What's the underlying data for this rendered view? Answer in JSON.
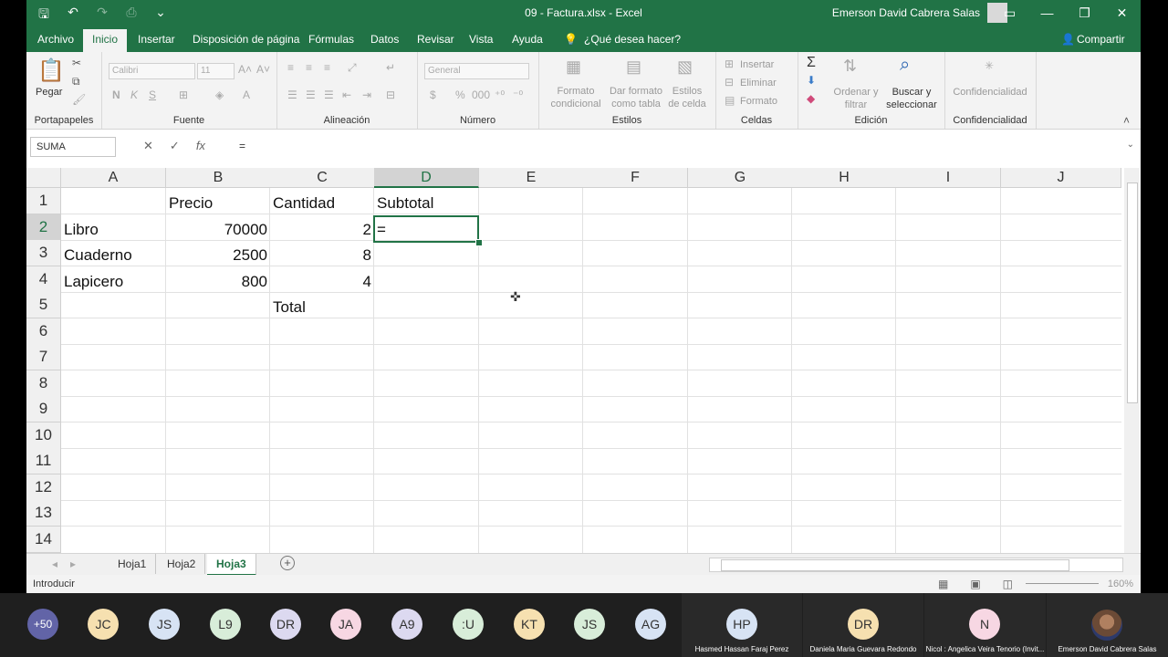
{
  "window": {
    "title": "09 - Factura.xlsx  -  Excel",
    "user": "Emerson David Cabrera Salas"
  },
  "qat_icons": [
    "save-icon",
    "undo-icon",
    "redo-icon",
    "print-preview-icon",
    "customize-icon"
  ],
  "ribbon_tabs": [
    "Archivo",
    "Inicio",
    "Insertar",
    "Disposición de página",
    "Fórmulas",
    "Datos",
    "Revisar",
    "Vista",
    "Ayuda"
  ],
  "tell_me": "¿Qué desea hacer?",
  "share": "Compartir",
  "ribbon": {
    "clipboard": {
      "label": "Portapapeles",
      "paste": "Pegar"
    },
    "font": {
      "label": "Fuente",
      "font_name": "Calibri",
      "font_size": "11",
      "bold": "N",
      "italic": "K",
      "underline": "S"
    },
    "alignment": {
      "label": "Alineación"
    },
    "number": {
      "label": "Número",
      "format": "General",
      "currency": "$",
      "percent": "%",
      "thousands": "000"
    },
    "styles": {
      "label": "Estilos",
      "conditional": "Formato condicional",
      "as_table": "Dar formato como tabla",
      "cell_styles": "Estilos de celda"
    },
    "cells": {
      "label": "Celdas",
      "insert": "Insertar",
      "delete": "Eliminar",
      "format": "Formato"
    },
    "editing": {
      "label": "Edición",
      "sort": "Ordenar y filtrar",
      "find": "Buscar y seleccionar"
    },
    "sensitivity": {
      "label": "Confidencialidad",
      "button": "Confidencialidad"
    }
  },
  "formula_bar": {
    "name_box": "SUMA",
    "formula": "="
  },
  "columns": [
    "A",
    "B",
    "C",
    "D",
    "E",
    "F",
    "G",
    "H",
    "I",
    "J"
  ],
  "rows": [
    "1",
    "2",
    "3",
    "4",
    "5",
    "6",
    "7",
    "8",
    "9",
    "10",
    "11",
    "12",
    "13",
    "14"
  ],
  "cells": {
    "B1": "Precio",
    "C1": "Cantidad",
    "D1": "Subtotal",
    "A2": "Libro",
    "B2": "70000",
    "C2": "2",
    "D2": "=",
    "A3": "Cuaderno",
    "B3": "2500",
    "C3": "8",
    "A4": "Lapicero",
    "B4": "800",
    "C4": "4",
    "C5": "Total"
  },
  "active_cell": "D2",
  "sheets": [
    "Hoja1",
    "Hoja2",
    "Hoja3"
  ],
  "active_sheet": "Hoja3",
  "status": {
    "mode": "Introducir",
    "zoom": "160%"
  },
  "meeting": {
    "more_count": "+50",
    "participants": [
      {
        "initials": "JC",
        "color": "#f6e0b0"
      },
      {
        "initials": "JS",
        "color": "#d7e3f4"
      },
      {
        "initials": "L9",
        "color": "#d8edd9"
      },
      {
        "initials": "DR",
        "color": "#dcd9f0"
      },
      {
        "initials": "JA",
        "color": "#f7d7e3"
      },
      {
        "initials": "A9",
        "color": "#dcd9f0"
      },
      {
        "initials": ":U",
        "color": "#d8edd9"
      },
      {
        "initials": "KT",
        "color": "#f6e0b0"
      },
      {
        "initials": "JS",
        "color": "#d8edd9"
      },
      {
        "initials": "AG",
        "color": "#d7e3f4"
      }
    ],
    "tiles": [
      {
        "initials": "HP",
        "name": "Hasmed Hassan Faraj Perez",
        "color": "#d7e3f4"
      },
      {
        "initials": "DR",
        "name": "Daniela Maria Guevara Redondo",
        "color": "#f6e0b0"
      },
      {
        "initials": "N",
        "name": "Nicol : Angelica Veira Tenorio (Invit...",
        "color": "#f7d7e3"
      },
      {
        "name": "Emerson David Cabrera Salas"
      }
    ]
  }
}
